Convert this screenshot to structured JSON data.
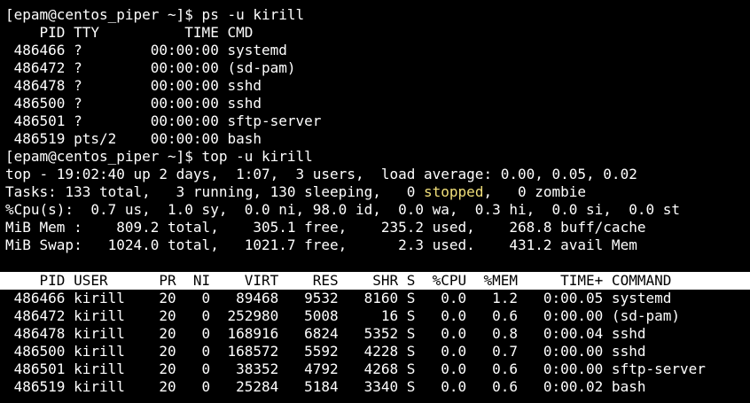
{
  "terminal": {
    "lines_before_top": [
      "[epam@centos_piper ~]$ ps -u kirill",
      "    PID TTY          TIME CMD",
      " 486466 ?        00:00:00 systemd",
      " 486472 ?        00:00:00 (sd-pam)",
      " 486478 ?        00:00:00 sshd",
      " 486500 ?        00:00:00 sshd",
      " 486501 ?        00:00:00 sftp-server",
      " 486519 pts/2    00:00:00 bash",
      "[epam@centos_piper ~]$ top -u kirill",
      "top - 19:02:40 up 2 days,  1:07,  3 users,  load average: 0.00, 0.05, 0.02"
    ],
    "tasks_line": {
      "prefix": "Tasks: 133 total,   3 running, 130 sleeping,   0 ",
      "stopped": "stopped",
      "suffix": ",   0 zombie"
    },
    "lines_after_tasks": [
      "%Cpu(s):  0.7 us,  1.0 sy,  0.0 ni, 98.0 id,  0.0 wa,  0.3 hi,  0.0 si,  0.0 st",
      "MiB Mem :    809.2 total,    305.1 free,    235.2 used,    268.8 buff/cache",
      "MiB Swap:   1024.0 total,   1021.7 free,      2.3 used.    431.2 avail Mem"
    ],
    "process_header": "    PID USER      PR  NI    VIRT    RES    SHR S  %CPU  %MEM     TIME+ COMMAND",
    "process_rows": [
      " 486466 kirill    20   0   89468   9532   8160 S   0.0   1.2   0:00.05 systemd",
      " 486472 kirill    20   0  252980   5008     16 S   0.0   0.6   0:00.00 (sd-pam)",
      " 486478 kirill    20   0  168916   6824   5352 S   0.0   0.8   0:00.04 sshd",
      " 486500 kirill    20   0  168572   5592   4228 S   0.0   0.7   0:00.00 sshd",
      " 486501 kirill    20   0   38352   4792   4268 S   0.0   0.6   0:00.00 sftp-server",
      " 486519 kirill    20   0   25284   5184   3340 S   0.0   0.6   0:00.02 bash"
    ]
  },
  "colors": {
    "background": "#000000",
    "foreground": "#ffffff",
    "header_bar_bg": "#ffffff",
    "header_bar_fg": "#000000",
    "stopped_highlight": "#f2e07a"
  }
}
